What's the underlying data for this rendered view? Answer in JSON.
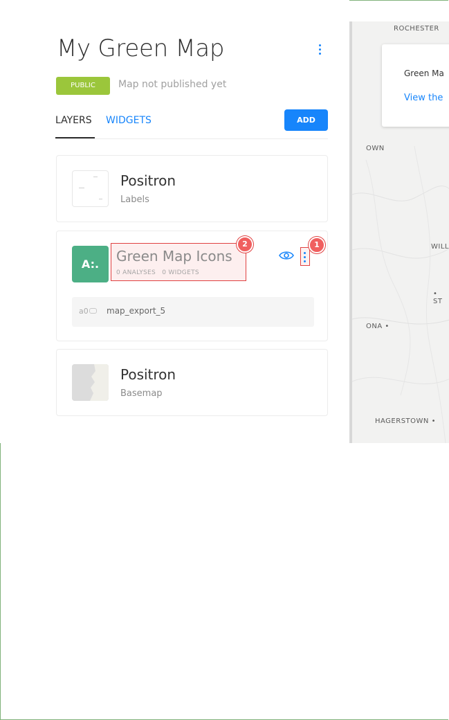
{
  "map": {
    "title": "My Green Map",
    "visibility_badge": "PUBLIC",
    "publish_status": "Map not published yet"
  },
  "tabs": [
    {
      "label": "LAYERS",
      "active": true
    },
    {
      "label": "WIDGETS",
      "active": false
    }
  ],
  "toolbar": {
    "add_label": "ADD"
  },
  "layers": [
    {
      "name": "Positron",
      "subtitle": "Labels"
    },
    {
      "name": "Green Map Icons",
      "letter": "A:.",
      "analyses": "0 ANALYSES",
      "widgets": "0 WIDGETS",
      "source_id": "a0",
      "source_name": "map_export_5",
      "color": "#4caf85"
    },
    {
      "name": "Positron",
      "subtitle": "Basemap"
    }
  ],
  "annotations": [
    {
      "number": "1"
    },
    {
      "number": "2"
    }
  ],
  "map_preview": {
    "popup_title": "Green Ma",
    "popup_link": "View the",
    "place_labels": [
      "ROCHESTER",
      "OWN",
      "WILL",
      "• ST",
      "ONA •",
      "HAGERSTOWN •"
    ]
  },
  "colors": {
    "accent": "#1785fb",
    "badge_green": "#9bc63b",
    "annotation_red": "#e04040"
  }
}
